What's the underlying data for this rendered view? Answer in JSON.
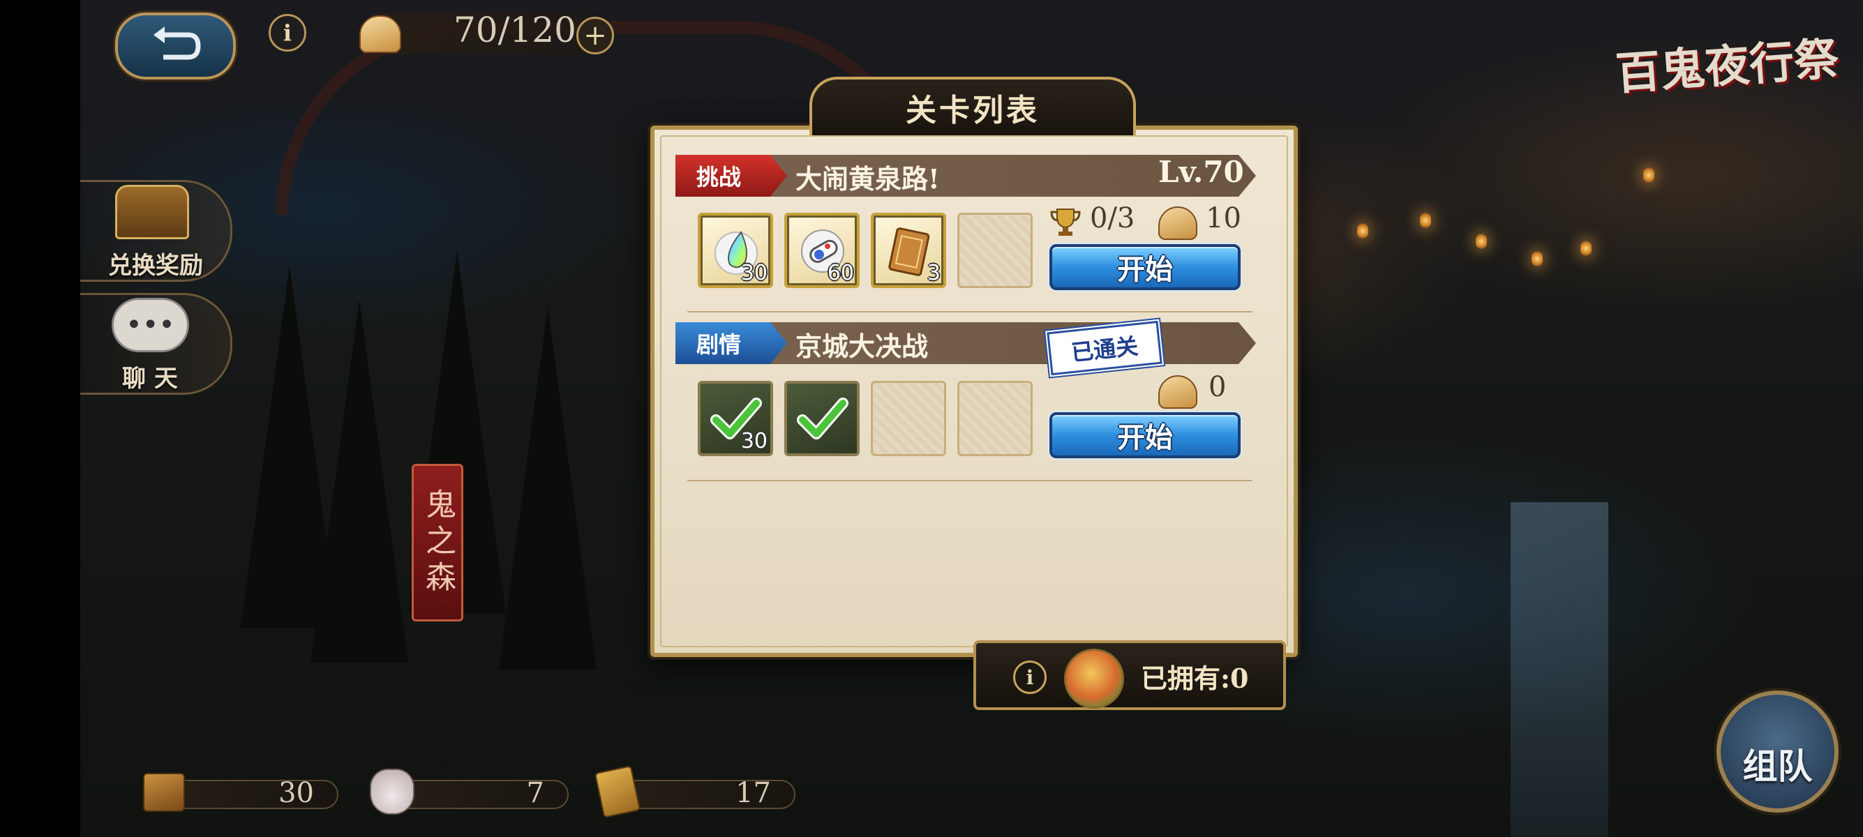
{
  "top_bar": {
    "stamina": "70/120",
    "plus": "+",
    "info": "i"
  },
  "logo": {
    "text": "百鬼夜行祭"
  },
  "side_menu": [
    {
      "label": "兑换奖励",
      "icon": "treasure-chest-icon"
    },
    {
      "label": "聊 天",
      "icon": "chat-bubble-icon"
    }
  ],
  "area_sign": "鬼之森",
  "panel": {
    "title": "关卡列表",
    "stages": [
      {
        "tag": "挑战",
        "tag_color": "#c62a24",
        "name": "大闹黄泉路!",
        "level": "Lv.70",
        "rewards": [
          {
            "icon": "rainbow-droplet-icon",
            "count": "30"
          },
          {
            "icon": "scroll-badge-icon",
            "count": "60"
          },
          {
            "icon": "ticket-card-icon",
            "count": "3"
          }
        ],
        "trophy": "0/3",
        "cost": "10",
        "start_label": "开始"
      },
      {
        "tag": "剧情",
        "tag_color": "#2f7cd0",
        "name": "京城大决战",
        "cleared_label": "已通关",
        "rewards": [
          {
            "icon": "checkmark-icon",
            "count": "30"
          },
          {
            "icon": "checkmark-icon",
            "count": ""
          }
        ],
        "cost": "0",
        "start_label": "开始"
      }
    ]
  },
  "owned": {
    "label": "已拥有:",
    "value": "0",
    "info": "i"
  },
  "inventory": [
    {
      "icon": "crate-icon",
      "value": "30"
    },
    {
      "icon": "pouch-icon",
      "value": "7"
    },
    {
      "icon": "scroll-icon",
      "value": "17"
    }
  ],
  "team_button": "组队"
}
